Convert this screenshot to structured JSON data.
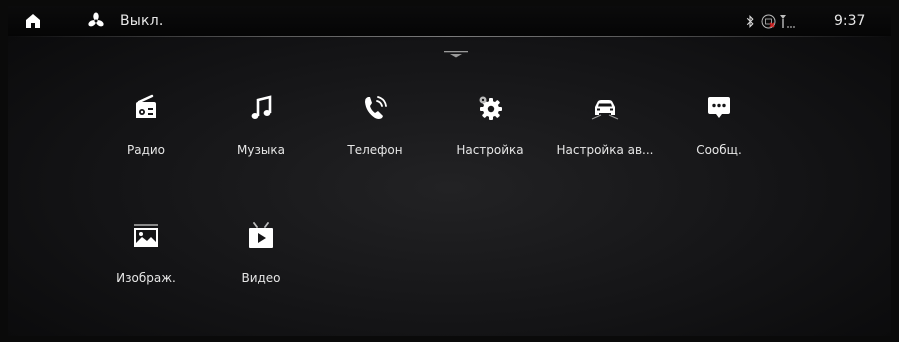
{
  "status_bar": {
    "fan_status": "Выкл.",
    "clock": "9:37",
    "icons": [
      "home-icon",
      "fan-icon",
      "bluetooth-icon",
      "no-sim-icon",
      "signal-icon"
    ]
  },
  "apps": [
    {
      "label": "Радио",
      "icon": "radio-icon"
    },
    {
      "label": "Музыка",
      "icon": "music-icon"
    },
    {
      "label": "Телефон",
      "icon": "phone-icon"
    },
    {
      "label": "Настройка",
      "icon": "gear-icon"
    },
    {
      "label": "Настройка ав...",
      "icon": "car-icon"
    },
    {
      "label": "Сообщ.",
      "icon": "message-icon"
    },
    {
      "label": "Изображ.",
      "icon": "image-icon"
    },
    {
      "label": "Видео",
      "icon": "video-icon"
    }
  ],
  "colors": {
    "background": "#141416",
    "icon": "#ffffff",
    "text": "#e6e6e6"
  }
}
